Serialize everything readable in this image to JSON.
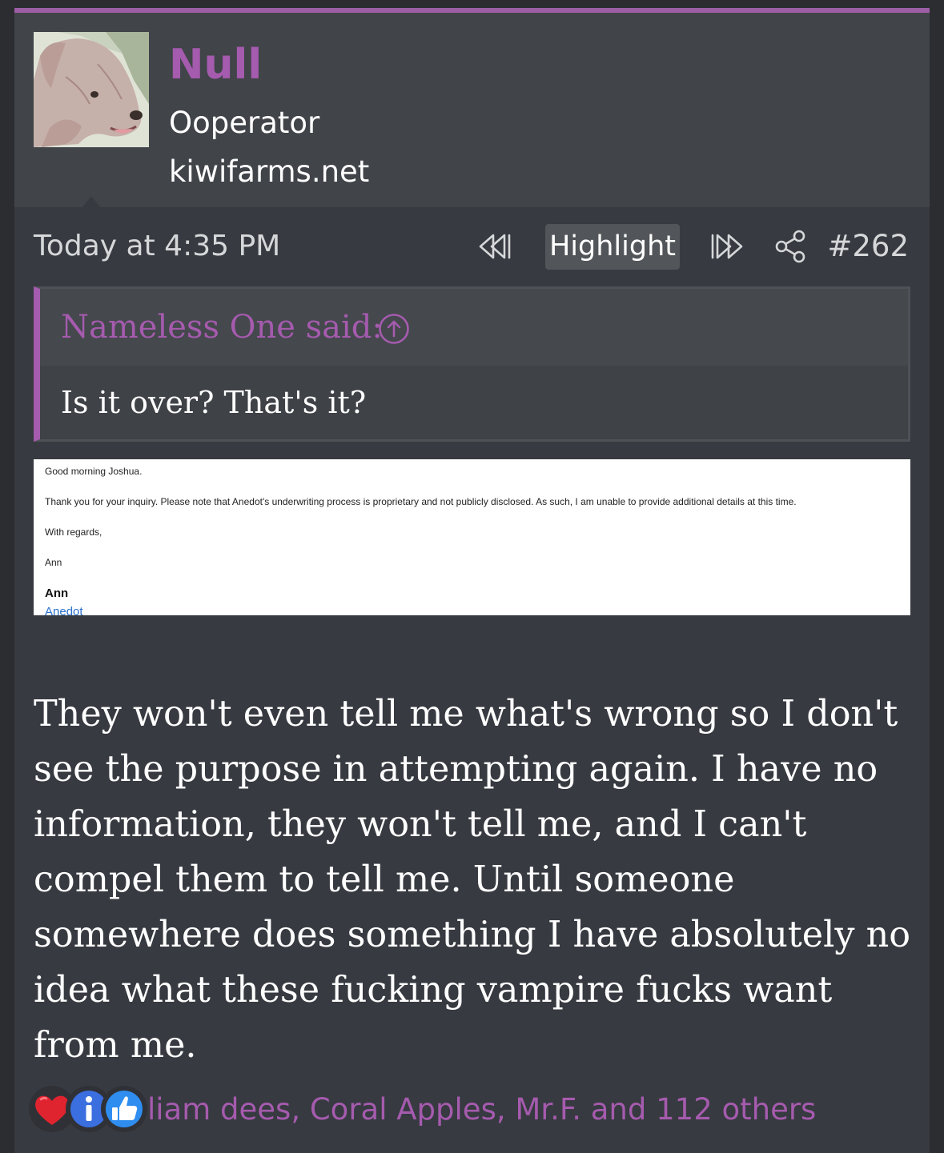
{
  "user": {
    "name": "Null",
    "title": "Ooperator",
    "site": "kiwifarms.net"
  },
  "post": {
    "date": "Today at 4:35 PM",
    "highlight_label": "Highlight",
    "number": "#262"
  },
  "quote": {
    "author": "Nameless One said:",
    "text": "Is it over? That's it?"
  },
  "attachment": {
    "greeting": "Good morning Joshua.",
    "body": "Thank you for your inquiry. Please note that Anedot's underwriting process is proprietary and not publicly disclosed. As such, I am unable to provide additional details at this time.",
    "closing": "With regards,",
    "sender": "Ann",
    "signature_name": "Ann",
    "signature_company": "Anedot"
  },
  "body": {
    "text": "They won't even tell me what's wrong so I don't see the purpose in attempting again. I have no information, they won't tell me, and I can't compel them to tell me. Until someone somewhere does something I have absolutely no idea what these fucking vampire fucks want from me."
  },
  "reactions": {
    "icons": [
      "heart-icon",
      "info-icon",
      "thumbs-up-icon"
    ],
    "summary": "liam dees, Coral Apples, Mr.F. and 112 others"
  },
  "colors": {
    "accent": "#a55bae",
    "background": "#373a40",
    "header": "#414449"
  }
}
